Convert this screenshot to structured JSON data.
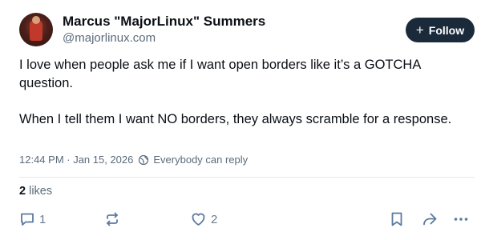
{
  "author": {
    "display_name": "Marcus \"MajorLinux\" Summers",
    "handle": "@majorlinux.com"
  },
  "follow_button": {
    "label": "Follow",
    "icon": "plus-icon"
  },
  "post": {
    "paragraphs": [
      "I love when people ask me if I want open borders like it’s a GOTCHA question.",
      "When I tell them I want NO borders, they always scramble for a response."
    ],
    "timestamp": "12:44 PM · Jan 15, 2026",
    "reply_setting": "Everybody can reply"
  },
  "likes": {
    "count": "2",
    "label": "likes"
  },
  "actions": {
    "reply_count": "1",
    "repost_count": "",
    "like_count": "2"
  },
  "icons": [
    "reply-icon",
    "repost-icon",
    "heart-icon",
    "bookmark-icon",
    "share-icon",
    "more-icon",
    "globe-icon"
  ],
  "colors": {
    "text": "#0b0f14",
    "muted": "#5b6b7b",
    "follow_bg": "#1b2a3a",
    "divider": "#e3e8ed"
  }
}
